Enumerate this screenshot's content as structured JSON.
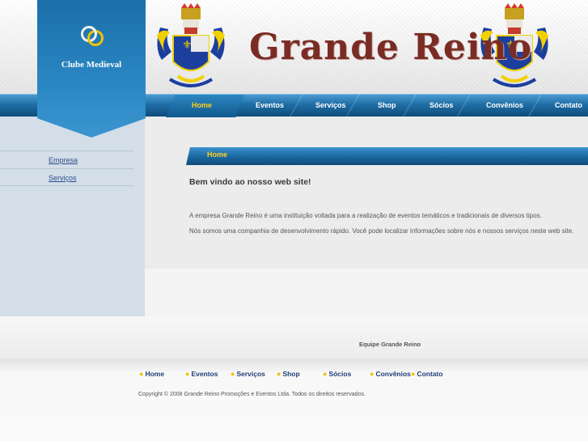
{
  "header": {
    "logo_text": "Clube Medieval",
    "site_title": "Grande Reino"
  },
  "nav": {
    "items": [
      {
        "label": "Home",
        "active": true
      },
      {
        "label": "Eventos",
        "active": false
      },
      {
        "label": "Serviços",
        "active": false
      },
      {
        "label": "Shop",
        "active": false
      },
      {
        "label": "Sócios",
        "active": false
      },
      {
        "label": "Convênios",
        "active": false
      },
      {
        "label": "Contato",
        "active": false
      }
    ]
  },
  "sidebar": {
    "items": [
      {
        "label": "Empresa"
      },
      {
        "label": "Serviços"
      }
    ]
  },
  "content": {
    "section_label": "Home",
    "welcome": "Bem vindo ao nosso web site!",
    "paragraphs": [
      "A empresa Grande Reino é uma instituição voltada para a realização de eventos temáticos e tradicionais de diversos tipos.",
      "Nós somos uma companhia de desenvolvimento rápido. Você pode localizar informações sobre nós e nossos serviços neste web site."
    ],
    "signature": "Equipe Grande Reino"
  },
  "footer": {
    "links": [
      {
        "label": "Home"
      },
      {
        "label": "Eventos"
      },
      {
        "label": "Serviços"
      },
      {
        "label": "Shop"
      },
      {
        "label": "Sócios"
      },
      {
        "label": "Convênios"
      },
      {
        "label": "Contato"
      }
    ],
    "copyright": "Copyright © 2008 Grande Reino Promoções e Eventos Ltda. Todos os direitos reservados."
  },
  "colors": {
    "nav_active": "#ffd21a",
    "nav_blue": "#1f6ea5",
    "title_red": "#7a2c24",
    "footer_link": "#1f3d78",
    "footer_dot": "#f2c200"
  },
  "icons": {
    "logo": "two-rings-icon",
    "crest": "coat-of-arms-icon"
  }
}
